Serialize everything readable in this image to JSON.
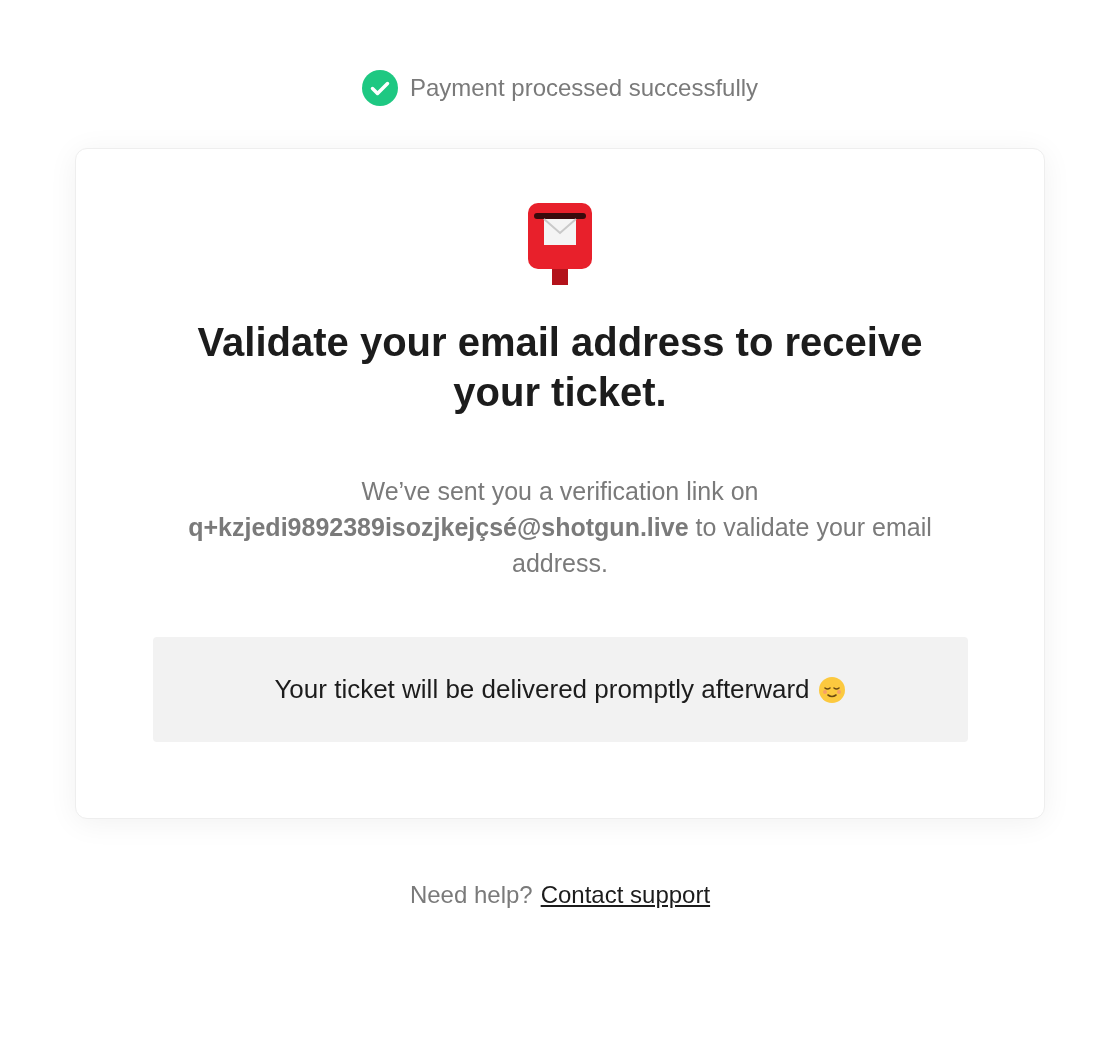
{
  "status": {
    "text": "Payment processed successfully"
  },
  "card": {
    "title": "Validate your email address to receive your ticket.",
    "message": "We’ve sent you a verification link on **q+kzjedi9892389isozjkejçsé@shotgun.live** to validate your email address.",
    "notice": "Your ticket will be delivered promptly afterward"
  },
  "footer": {
    "text": "Need help?",
    "link": "Contact support"
  }
}
